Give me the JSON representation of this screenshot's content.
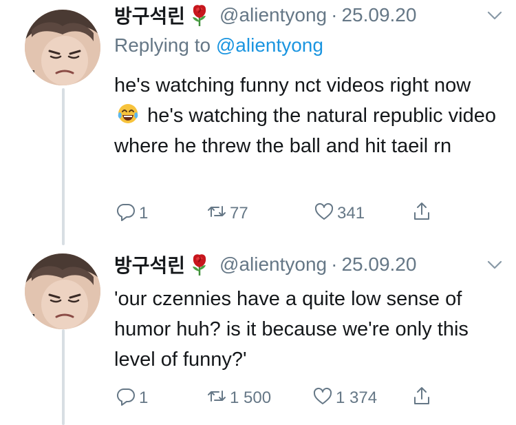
{
  "thread": [
    {
      "author": {
        "display_name": "방구석린",
        "handle": "@alientyong",
        "badge_icon": "rose-icon"
      },
      "date": "25.09.20",
      "separator": "·",
      "replying_to": {
        "prefix": "Replying to ",
        "handle": "@alientyong"
      },
      "text_parts": {
        "a": "he's watching funny nct videos right now",
        "emoji": "face-with-tears-of-joy-icon",
        "b": "he's watching the natural republic video where he threw the ball and hit taeil rn"
      },
      "stats": {
        "replies": "1",
        "retweets": "77",
        "likes": "341"
      }
    },
    {
      "author": {
        "display_name": "방구석린",
        "handle": "@alientyong",
        "badge_icon": "rose-icon"
      },
      "date": "25.09.20",
      "separator": "·",
      "text": "'our czennies have a quite low sense of humor huh? is it because we're only this level of funny?'",
      "stats": {
        "replies": "1",
        "retweets": "1 500",
        "likes": "1 374"
      }
    }
  ],
  "colors": {
    "text": "#14171a",
    "secondary": "#657786",
    "link": "#1b95e0",
    "thread_line": "#d8dee3"
  }
}
